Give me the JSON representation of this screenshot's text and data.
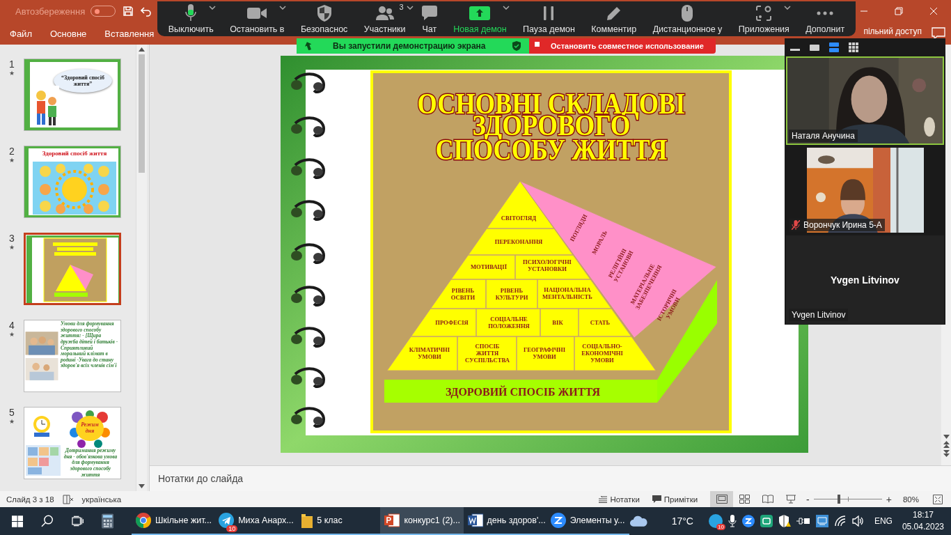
{
  "title_bar": {
    "autosave": "Автозбереження",
    "autosave_on": false
  },
  "ribbon_tabs": [
    {
      "label": "Файл"
    },
    {
      "label": "Основне"
    },
    {
      "label": "Вставлення"
    }
  ],
  "ribbon_share": "пільний доступ",
  "meeting_toolbar": {
    "items": [
      {
        "kind": "mic",
        "label": "Выключить",
        "caret": true,
        "highlighted": false
      },
      {
        "kind": "video",
        "label": "Остановить в",
        "caret": true,
        "highlighted": false
      },
      {
        "kind": "security",
        "label": "Безопаснос",
        "caret": false,
        "highlighted": false
      },
      {
        "kind": "participants",
        "label": "Участники",
        "count": "3",
        "caret": true,
        "highlighted": false
      },
      {
        "kind": "chat",
        "label": "Чат",
        "caret": false,
        "highlighted": false
      },
      {
        "kind": "share",
        "label": "Новая демон",
        "caret": true,
        "highlighted": true
      },
      {
        "kind": "pause",
        "label": "Пауза демон",
        "caret": false,
        "highlighted": false
      },
      {
        "kind": "annotate",
        "label": "Комментир",
        "caret": false,
        "highlighted": false
      },
      {
        "kind": "remote",
        "label": "Дистанционное у",
        "caret": false,
        "highlighted": false
      },
      {
        "kind": "apps",
        "label": "Приложения",
        "caret": true,
        "highlighted": false
      },
      {
        "kind": "more",
        "label": "Дополнит",
        "caret": false,
        "highlighted": false
      }
    ]
  },
  "share_banner": {
    "notice": "Вы запустили демонстрацию экрана",
    "stop": "Остановить совместное использование"
  },
  "thumbnails": [
    {
      "number": "1",
      "mark": "★",
      "selected": false,
      "kind": "title",
      "texts": [
        "“Здоровий спосіб життя”"
      ]
    },
    {
      "number": "2",
      "mark": "★",
      "selected": false,
      "kind": "sun",
      "texts": [
        "Здоровий спосіб життя"
      ]
    },
    {
      "number": "3",
      "mark": "★",
      "selected": true,
      "kind": "pyramid"
    },
    {
      "number": "4",
      "mark": "★",
      "selected": false,
      "kind": "family",
      "texts": [
        "Умови для формування здорового способу життя: - [Щира дружба дітей і батьків - Сприятливий моральний клімат в родині -Увага до стану здоров'я всіх членів сім'ї"
      ]
    },
    {
      "number": "5",
      "mark": "★",
      "selected": false,
      "kind": "schedule",
      "texts": [
        "Режим дня",
        "Дотримання режиму дня - обов'язкова умова для формування здорового способу життя"
      ]
    }
  ],
  "slide": {
    "title_lines": [
      "ОСНОВНІ СКЛАДОВІ",
      "ЗДОРОВОГО",
      "СПОСОБУ ЖИТТЯ"
    ],
    "pyramid_rows": [
      [
        {
          "lines": [
            "СВІТОГЛЯД"
          ]
        }
      ],
      [
        {
          "lines": [
            "ПЕРЕКОНАННЯ"
          ]
        }
      ],
      [
        {
          "lines": [
            "МОТИВАЦІЇ"
          ]
        },
        {
          "lines": [
            "ПСИХОЛОГІЧНІ",
            "УСТАНОВКИ"
          ]
        }
      ],
      [
        {
          "lines": [
            "РІВЕНЬ",
            "ОСВІТИ"
          ]
        },
        {
          "lines": [
            "РІВЕНЬ",
            "КУЛЬТУРИ"
          ]
        },
        {
          "lines": [
            "НАЦІОНАЛЬНА",
            "МЕНТАЛЬНІСТЬ"
          ]
        }
      ],
      [
        {
          "lines": [
            "ПРОФЕСІЯ"
          ]
        },
        {
          "lines": [
            "СОЦІАЛЬНЕ",
            "ПОЛОЖЕННЯ"
          ]
        },
        {
          "lines": [
            "ВІК"
          ]
        },
        {
          "lines": [
            "СТАТЬ"
          ]
        }
      ],
      [
        {
          "lines": [
            "КЛІМАТИЧНІ",
            "УМОВИ"
          ]
        },
        {
          "lines": [
            "СПОСІБ",
            "ЖИТТЯ",
            "СУСПІЛЬСТВА"
          ]
        },
        {
          "lines": [
            "ГЕОГРАФІЧНІ",
            "УМОВИ"
          ]
        },
        {
          "lines": [
            "СОЦІАЛЬНО-",
            "ЕКОНОМІЧНІ",
            "УМОВИ"
          ]
        }
      ]
    ],
    "side_labels": [
      {
        "lines": [
          "ПОГЛЯДИ"
        ]
      },
      {
        "lines": [
          "МОРАЛЬ"
        ]
      },
      {
        "lines": [
          "РЕЛІГІЙНІ",
          "УСТАНОВИ"
        ]
      },
      {
        "lines": [
          "МАТЕРІАЛЬНЕ",
          "ЗАБЕЗПЕЧЕННЯ"
        ]
      },
      {
        "lines": [
          "ІСТОРИЧНІ",
          "УМОВИ"
        ]
      }
    ],
    "base": "ЗДОРОВИЙ СПОСІБ ЖИТТЯ"
  },
  "notes_placeholder": "Нотатки до слайда",
  "video_panel": {
    "layouts": [
      {
        "kind": "minimize",
        "selected": false
      },
      {
        "kind": "single",
        "selected": false
      },
      {
        "kind": "side",
        "selected": true
      },
      {
        "kind": "grid",
        "selected": false
      }
    ],
    "tiles": [
      {
        "kind": "video",
        "name": "Наталя Анучина",
        "speaking": true,
        "muted": false
      },
      {
        "kind": "video",
        "name": "Ворончук Ирина 5-А",
        "speaking": false,
        "muted": true
      },
      {
        "kind": "no_video",
        "caption": "Yvgen Litvinov",
        "name": "Yvgen Litvinov",
        "speaking": false,
        "muted": false
      }
    ]
  },
  "status_bar": {
    "slide": "Слайд 3 з 18",
    "language": "українська",
    "notes": "Нотатки",
    "comments": "Примітки",
    "views": [
      {
        "kind": "normal",
        "selected": true
      },
      {
        "kind": "sorter",
        "selected": false
      },
      {
        "kind": "reading",
        "selected": false
      },
      {
        "kind": "show",
        "selected": false
      }
    ],
    "minus": "-",
    "plus": "+",
    "level": 0.37,
    "zoom": "80%"
  },
  "taskbar": {
    "apps": [
      {
        "kind": "chrome",
        "label": "Шкільне жит...",
        "selected": false
      },
      {
        "kind": "telegram",
        "label": "Миха Анарх...",
        "badge": "10",
        "selected": false
      },
      {
        "kind": "folder",
        "label": "5 клас",
        "selected": false
      },
      {
        "kind": "powerpoint",
        "label": "конкурс1 (2)...",
        "selected": true
      },
      {
        "kind": "word",
        "label": "день здоров'...",
        "selected": false
      },
      {
        "kind": "zoom",
        "label": "Элементы у...",
        "selected": false
      }
    ],
    "temperature": "17°C",
    "tray_badge": "10",
    "language": "ENG",
    "time": "18:17",
    "date": "05.04.2023"
  }
}
